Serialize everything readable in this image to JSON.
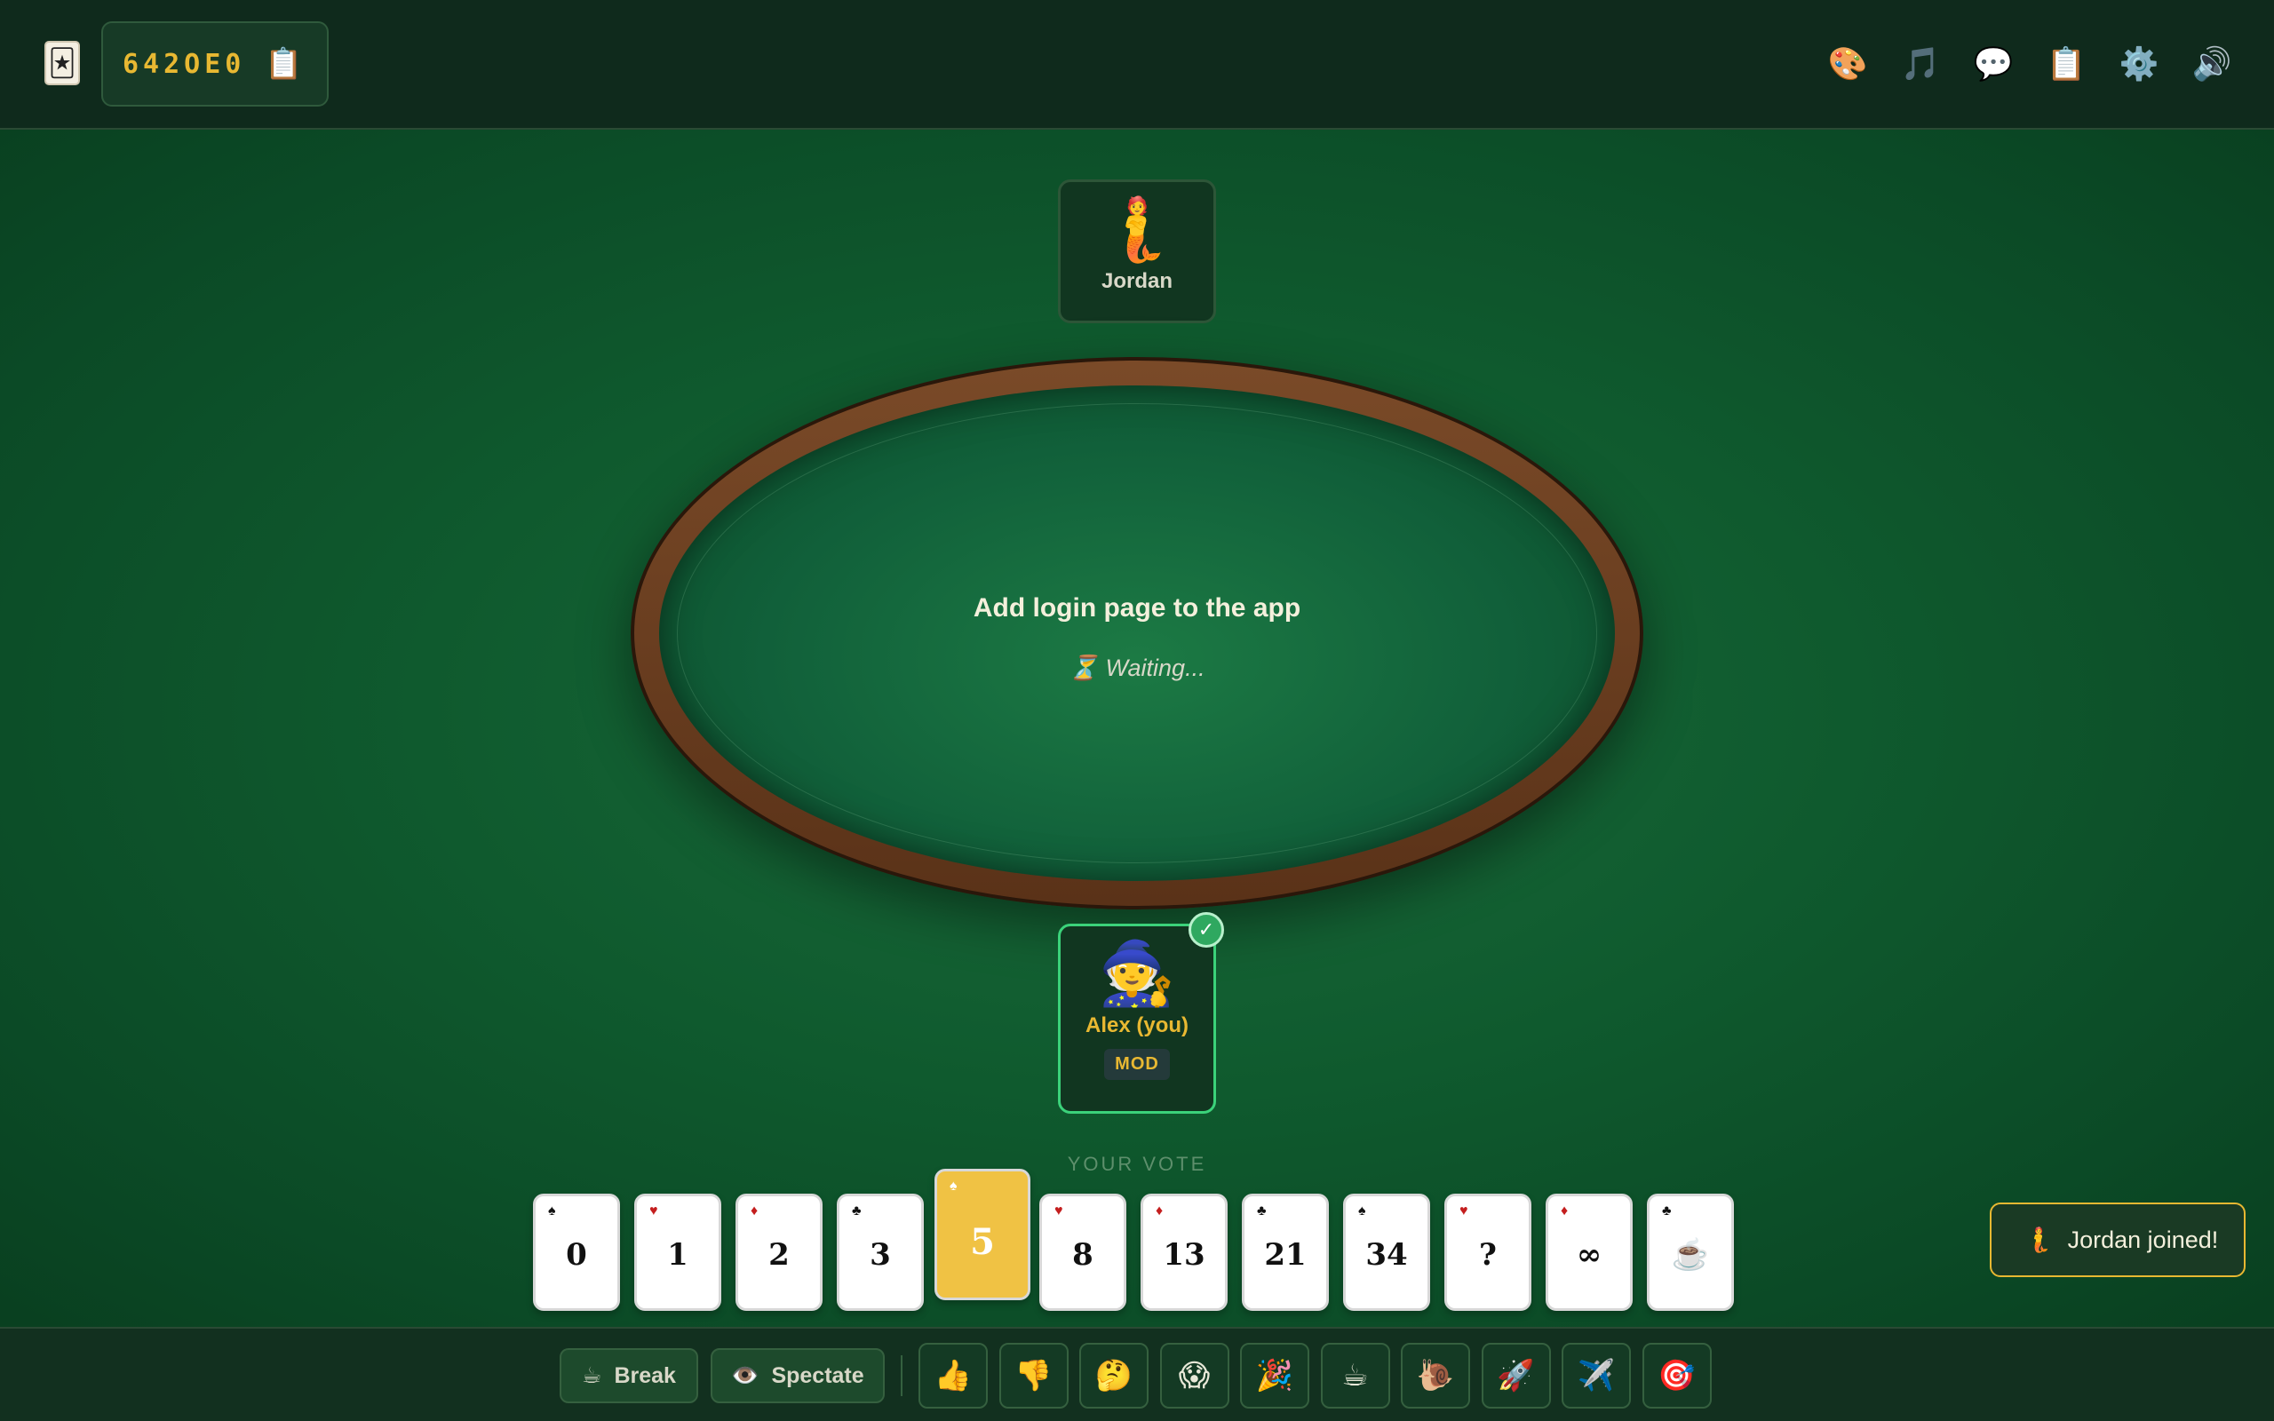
{
  "header": {
    "logo_icon": "🃏",
    "room_code": "642OE0",
    "copy_icon": "📋",
    "icons": [
      {
        "name": "palette-icon",
        "glyph": "🎨"
      },
      {
        "name": "music-icon",
        "glyph": "🎵"
      },
      {
        "name": "chat-icon",
        "glyph": "💬"
      },
      {
        "name": "clipboard-icon",
        "glyph": "📋"
      },
      {
        "name": "settings-gear-icon",
        "glyph": "⚙️"
      },
      {
        "name": "sound-icon",
        "glyph": "🔊"
      }
    ]
  },
  "players": {
    "top": {
      "avatar": "🧜",
      "name": "Jordan"
    },
    "bottom": {
      "avatar": "🧙",
      "name": "Alex (you)",
      "badge": "MOD",
      "voted_mark": "✓"
    }
  },
  "table": {
    "story_title": "Add login page to the app",
    "status_icon": "⏳",
    "status_text": "Waiting..."
  },
  "vote": {
    "label": "YOUR VOTE",
    "selected": "5",
    "cards": [
      {
        "value": "0",
        "suit": "♠",
        "red": false
      },
      {
        "value": "1",
        "suit": "♥",
        "red": true
      },
      {
        "value": "2",
        "suit": "♦",
        "red": true
      },
      {
        "value": "3",
        "suit": "♣",
        "red": false
      },
      {
        "value": "5",
        "suit": "♠",
        "red": false
      },
      {
        "value": "8",
        "suit": "♥",
        "red": true
      },
      {
        "value": "13",
        "suit": "♦",
        "red": true
      },
      {
        "value": "21",
        "suit": "♣",
        "red": false
      },
      {
        "value": "34",
        "suit": "♠",
        "red": false
      },
      {
        "value": "?",
        "suit": "♥",
        "red": true
      },
      {
        "value": "∞",
        "suit": "♦",
        "red": true
      },
      {
        "value": "☕",
        "suit": "♣",
        "red": false
      }
    ]
  },
  "actions": {
    "break_icon": "☕",
    "break_label": "Break",
    "spectate_icon": "👁️",
    "spectate_label": "Spectate"
  },
  "reactions": [
    {
      "name": "thumbs-up-icon",
      "glyph": "👍"
    },
    {
      "name": "thumbs-down-icon",
      "glyph": "👎"
    },
    {
      "name": "thinking-face-icon",
      "glyph": "🤔"
    },
    {
      "name": "scream-face-icon",
      "glyph": "😱"
    },
    {
      "name": "party-popper-icon",
      "glyph": "🎉"
    },
    {
      "name": "coffee-icon",
      "glyph": "☕"
    },
    {
      "name": "snail-icon",
      "glyph": "🐌"
    },
    {
      "name": "rocket-icon",
      "glyph": "🚀"
    },
    {
      "name": "airplane-icon",
      "glyph": "✈️"
    },
    {
      "name": "target-icon",
      "glyph": "🎯"
    }
  ],
  "toast": {
    "icon": "🧜",
    "text": "Jordan joined!"
  }
}
